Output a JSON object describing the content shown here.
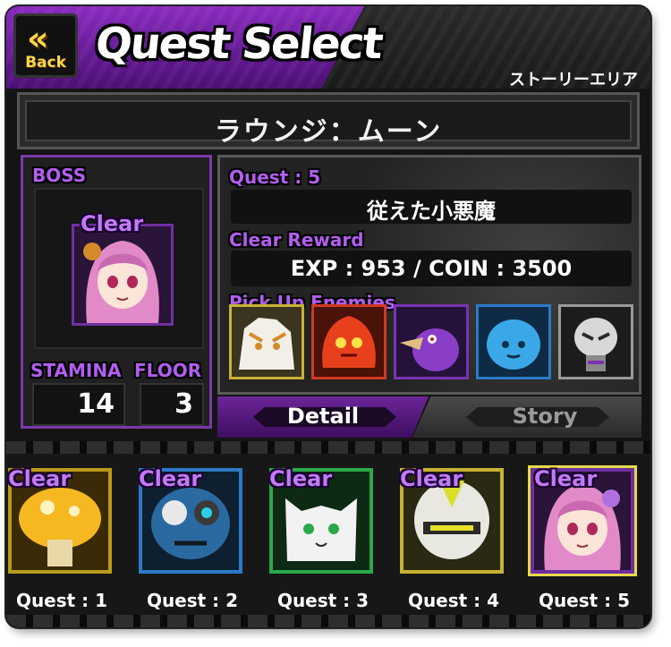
{
  "header": {
    "back_label": "Back",
    "back_chevrons": "«",
    "title": "Quest Select",
    "area_label": "ストーリーエリア"
  },
  "stage": {
    "name": "ラウンジ：ムーン"
  },
  "boss": {
    "label": "BOSS",
    "clear_label": "Clear",
    "stamina_label": "STAMINA",
    "stamina_value": "14",
    "floor_label": "FLOOR",
    "floor_value": "3"
  },
  "quest_info": {
    "quest_label": "Quest : 5",
    "quest_name": "従えた小悪魔",
    "reward_label": "Clear Reward",
    "reward_text": "EXP : 953 / COIN : 3500",
    "enemies_label": "Pick Up Enemies",
    "enemies": [
      {
        "icon": "white-tiger-monster-icon",
        "frame": "#c8b233"
      },
      {
        "icon": "red-fire-spirit-icon",
        "frame": "#d03a20"
      },
      {
        "icon": "purple-crow-icon",
        "frame": "#7a33b0"
      },
      {
        "icon": "blue-slime-icon",
        "frame": "#2a7ac8"
      },
      {
        "icon": "silver-robot-icon",
        "frame": "#9a9a9a"
      }
    ]
  },
  "tabs": {
    "detail": "Detail",
    "story": "Story"
  },
  "quests": [
    {
      "caption": "Quest : 1",
      "clear": "Clear",
      "icon": "yellow-mushroom-icon",
      "frame": "#b89b1a"
    },
    {
      "caption": "Quest : 2",
      "clear": "Clear",
      "icon": "blue-goggle-monster-icon",
      "frame": "#2a7ac8"
    },
    {
      "caption": "Quest : 3",
      "clear": "Clear",
      "icon": "white-cat-icon",
      "frame": "#2aa84a"
    },
    {
      "caption": "Quest : 4",
      "clear": "Clear",
      "icon": "knight-helmet-icon",
      "frame": "#c8b233"
    },
    {
      "caption": "Quest : 5",
      "clear": "Clear",
      "icon": "pink-hair-girl-icon",
      "frame": "#6f2fa0"
    }
  ],
  "colors": {
    "accent_purple": "#8a2bc0",
    "clear_purple": "#c27af7",
    "back_yellow": "#f5d74a"
  }
}
